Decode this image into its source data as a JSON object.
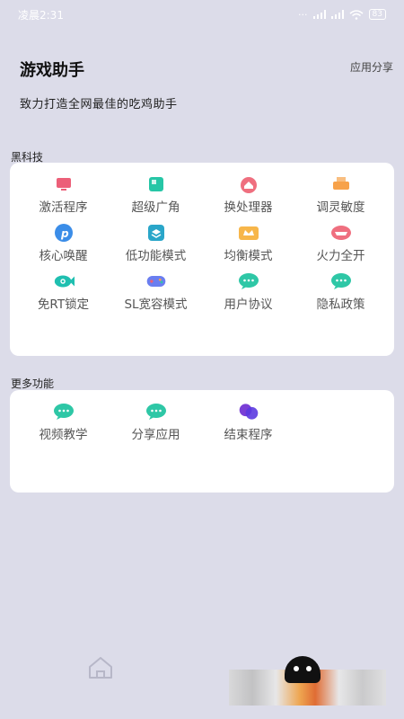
{
  "status": {
    "time": "凌晨2:31",
    "battery": "83"
  },
  "header": {
    "title": "游戏助手",
    "share": "应用分享",
    "slogan": "致力打造全网最佳的吃鸡助手"
  },
  "sections": [
    {
      "title": "黑科技",
      "items": [
        {
          "label": "激活程序",
          "icon": "monitor-icon",
          "color": "#ec5f78"
        },
        {
          "label": "超级广角",
          "icon": "image-icon",
          "color": "#26c6a6"
        },
        {
          "label": "换处理器",
          "icon": "home-icon",
          "color": "#ef6f7f"
        },
        {
          "label": "调灵敏度",
          "icon": "printer-icon",
          "color": "#f7a24a"
        },
        {
          "label": "核心唤醒",
          "icon": "p-circle-icon",
          "color": "#3b8de8"
        },
        {
          "label": "低功能模式",
          "icon": "layers-icon",
          "color": "#2aa6c9"
        },
        {
          "label": "均衡模式",
          "icon": "crown-icon",
          "color": "#f7b64a"
        },
        {
          "label": "火力全开",
          "icon": "car-icon",
          "color": "#ef6f7f"
        },
        {
          "label": "免RT锁定",
          "icon": "fish-icon",
          "color": "#1fbfb0"
        },
        {
          "label": "SL宽容模式",
          "icon": "gamepad-icon",
          "color": "#6a7ef0"
        },
        {
          "label": "用户协议",
          "icon": "chat-icon",
          "color": "#2ec7a6"
        },
        {
          "label": "隐私政策",
          "icon": "chat-icon",
          "color": "#2ec7a6"
        }
      ]
    },
    {
      "title": "更多功能",
      "items": [
        {
          "label": "视频教学",
          "icon": "chat-icon",
          "color": "#2ec7a6"
        },
        {
          "label": "分享应用",
          "icon": "chat-icon",
          "color": "#2ec7a6"
        },
        {
          "label": "结束程序",
          "icon": "circles-icon",
          "color": "#7a3fd6"
        }
      ]
    }
  ]
}
